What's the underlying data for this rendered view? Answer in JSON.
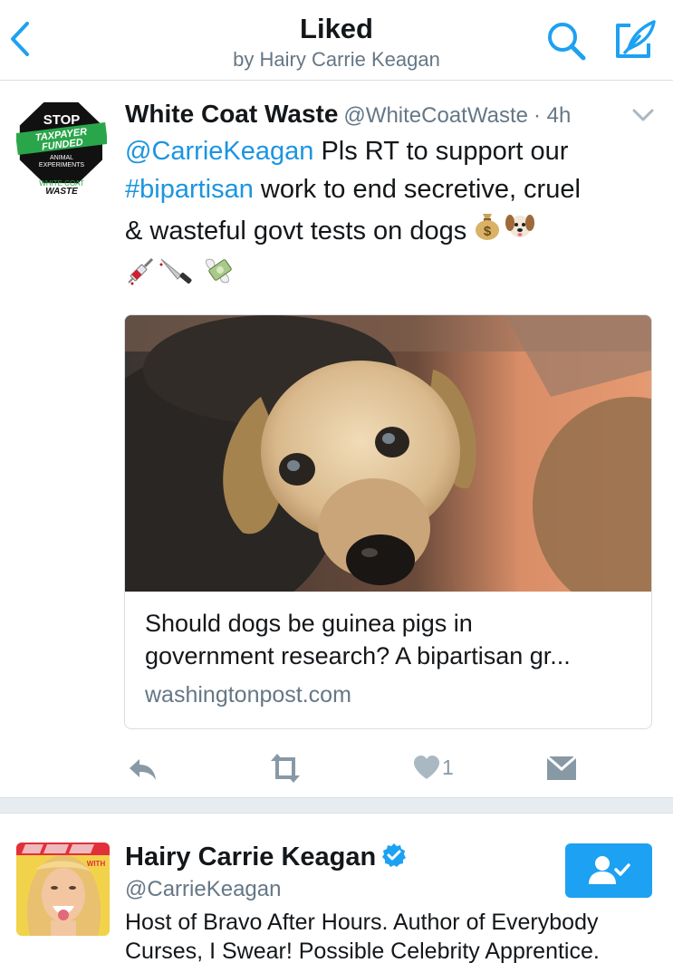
{
  "header": {
    "title": "Liked",
    "subtitle": "by Hairy Carrie Keagan"
  },
  "tweet": {
    "author_name": "White Coat Waste",
    "author_handle": "@WhiteCoatWaste",
    "time": "· 4h",
    "mention": "@CarrieKeagan",
    "line1_rest": " Pls RT to support our",
    "hashtag": "#bipartisan",
    "line2_rest": " work to end secretive, cruel",
    "line3": "& wasteful govt tests on dogs ",
    "avatar_text": {
      "stop": "STOP",
      "taxpayer": "TAXPAYER",
      "funded": "FUNDED",
      "animal": "ANIMAL",
      "experiments": "EXPERIMENTS",
      "org1": "WHITE COAT",
      "org2": "WASTE"
    },
    "card": {
      "title_line1": "Should dogs be guinea pigs in",
      "title_line2": "government research? A bipartisan gr...",
      "domain": "washingtonpost.com"
    },
    "like_count": "1"
  },
  "profile": {
    "name": "Hairy Carrie Keagan",
    "handle": "@CarrieKeagan",
    "bio_line1": "Host of Bravo After Hours. Author of Everybody",
    "bio_line2": "Curses, I Swear! Possible Celebrity Apprentice."
  },
  "icons": {
    "back": "chevron-left-icon",
    "search": "search-icon",
    "compose": "compose-icon",
    "caret": "chevron-down-icon",
    "reply": "reply-icon",
    "retweet": "retweet-icon",
    "like": "heart-icon",
    "dm": "direct-message-icon",
    "verified": "verified-badge-icon",
    "follow": "follow-user-icon"
  },
  "colors": {
    "accent": "#1da1f2",
    "link": "#1b95e0",
    "secondary_text": "#657786",
    "action_gray": "#8899a6",
    "separator": "#e6ecf0"
  }
}
